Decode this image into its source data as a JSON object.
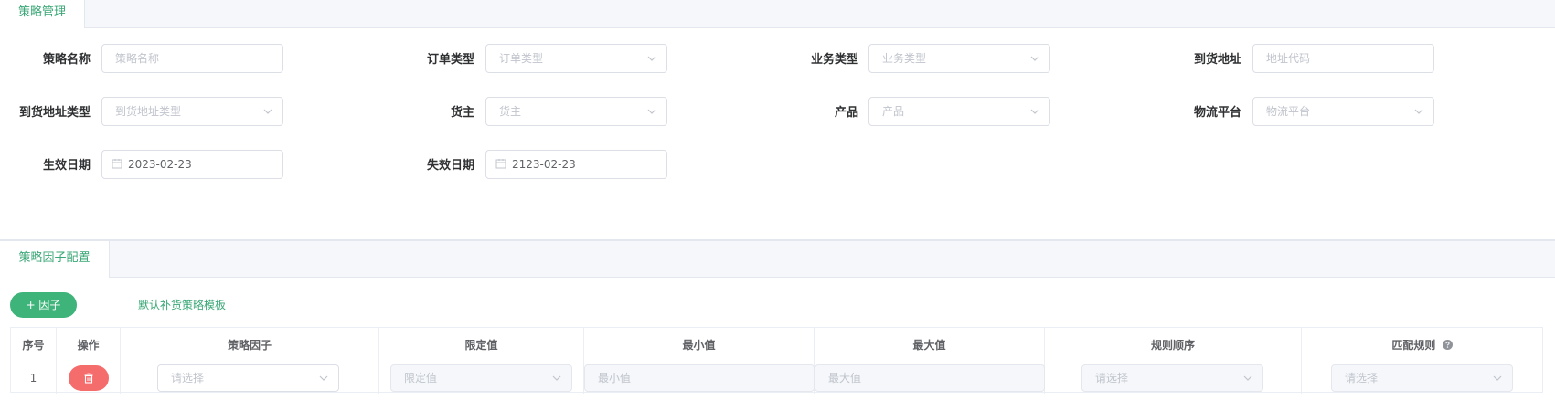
{
  "tabs": {
    "strategy": "策略管理",
    "factor_config": "策略因子配置"
  },
  "form": {
    "strategy_name": {
      "label": "策略名称",
      "placeholder": "策略名称"
    },
    "order_type": {
      "label": "订单类型",
      "placeholder": "订单类型"
    },
    "business_type": {
      "label": "业务类型",
      "placeholder": "业务类型"
    },
    "delivery_address": {
      "label": "到货地址",
      "placeholder": "地址代码"
    },
    "delivery_address_type": {
      "label": "到货地址类型",
      "placeholder": "到货地址类型"
    },
    "owner": {
      "label": "货主",
      "placeholder": "货主"
    },
    "product": {
      "label": "产品",
      "placeholder": "产品"
    },
    "logistics_platform": {
      "label": "物流平台",
      "placeholder": "物流平台"
    },
    "effective_date": {
      "label": "生效日期",
      "value": "2023-02-23"
    },
    "expiry_date": {
      "label": "失效日期",
      "value": "2123-02-23"
    }
  },
  "toolbar": {
    "add_factor_label": "+ 因子",
    "default_template_link": "默认补货策略模板"
  },
  "table": {
    "headers": [
      "序号",
      "操作",
      "策略因子",
      "限定值",
      "最小值",
      "最大值",
      "规则顺序",
      "匹配规则"
    ],
    "rows": [
      {
        "index": "1",
        "factor_placeholder": "请选择",
        "limit_placeholder": "限定值",
        "min_placeholder": "最小值",
        "max_placeholder": "最大值",
        "order_placeholder": "请选择",
        "match_placeholder": "请选择"
      }
    ]
  },
  "colors": {
    "accent": "#3aa776",
    "danger": "#f56c6c",
    "border": "#dcdfe6"
  }
}
